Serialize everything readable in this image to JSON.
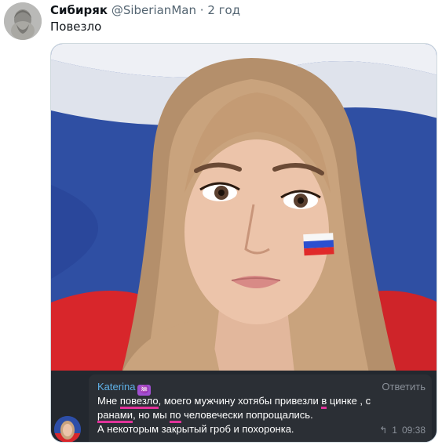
{
  "tweet": {
    "author_name": "Сибиряк",
    "handle": "@SiberianMan",
    "separator": "·",
    "time": "2 год",
    "text": "Повезло"
  },
  "telegram_message": {
    "sender": "Katerina",
    "sender_badge": "♒",
    "reply_label": "Ответить",
    "segments": [
      {
        "text": "Мне ",
        "underline": false
      },
      {
        "text": "повезло",
        "underline": true
      },
      {
        "text": ", моего мужчину хотябы  привезли ",
        "underline": false
      },
      {
        "text": "в",
        "underline": true
      },
      {
        "text": " цинке , с ",
        "underline": false
      },
      {
        "text": "ранами",
        "underline": true
      },
      {
        "text": ", но мы ",
        "underline": false
      },
      {
        "text": "по",
        "underline": true
      },
      {
        "text": " человечески попрощались.",
        "underline": false
      },
      {
        "text": "\nА некоторым закрытый гроб и похоронка.",
        "underline": false
      }
    ],
    "reply_icon": "reply-arrow-icon",
    "reply_count": "1",
    "time": "09:38"
  },
  "colors": {
    "flag_white": "#f4f4f6",
    "flag_blue": "#2142a6",
    "flag_red": "#d8262b",
    "telegram_bg": "#23282f",
    "sender_color": "#5fb1e8",
    "underline_color": "#e0339a"
  }
}
